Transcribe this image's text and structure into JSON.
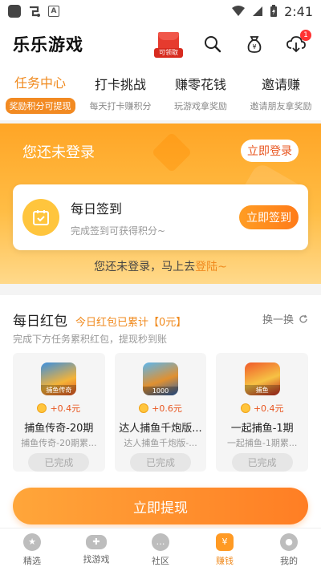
{
  "status_bar": {
    "time": "2:41"
  },
  "header": {
    "title": "乐乐游戏",
    "redpacket_label": "可领取",
    "message_badge": "1"
  },
  "tabs": [
    {
      "title": "任务中心",
      "sub": "奖励积分可提现"
    },
    {
      "title": "打卡挑战",
      "sub": "每天打卡赚积分"
    },
    {
      "title": "赚零花钱",
      "sub": "玩游戏拿奖励"
    },
    {
      "title": "邀请赚",
      "sub": "邀请朋友拿奖励"
    }
  ],
  "banner": {
    "text": "您还未登录",
    "login_button": "立即登录"
  },
  "sign_in": {
    "title": "每日签到",
    "subtitle": "完成签到可获得积分~",
    "button": "立即签到"
  },
  "notice": {
    "text": "您还未登录，马上去",
    "link": "登陆~"
  },
  "red_packet": {
    "title": "每日红包",
    "accumulated": "今日红包已累计【0元】",
    "refresh": "换一换",
    "description": "完成下方任务累积红包，提现秒到账",
    "cards": [
      {
        "icon_label": "捕鱼传奇",
        "reward": "+0.4元",
        "title": "捕鱼传奇-20期",
        "sub": "捕鱼传奇-20期累...",
        "status": "已完成"
      },
      {
        "icon_label": "1000",
        "reward": "+0.6元",
        "title": "达人捕鱼千炮版...",
        "sub": "达人捕鱼千炮版-...",
        "status": "已完成"
      },
      {
        "icon_label": "捕鱼",
        "reward": "+0.4元",
        "title": "一起捕鱼-1期",
        "sub": "一起捕鱼-1期累...",
        "status": "已完成"
      }
    ],
    "withdraw_button": "立即提现"
  },
  "bottom_nav": [
    {
      "label": "精选"
    },
    {
      "label": "找游戏"
    },
    {
      "label": "社区"
    },
    {
      "label": "赚钱"
    },
    {
      "label": "我的"
    }
  ],
  "colors": {
    "accent": "#f08a1e",
    "banner_top": "#ffa526",
    "banner_bottom": "#ffd98b"
  }
}
